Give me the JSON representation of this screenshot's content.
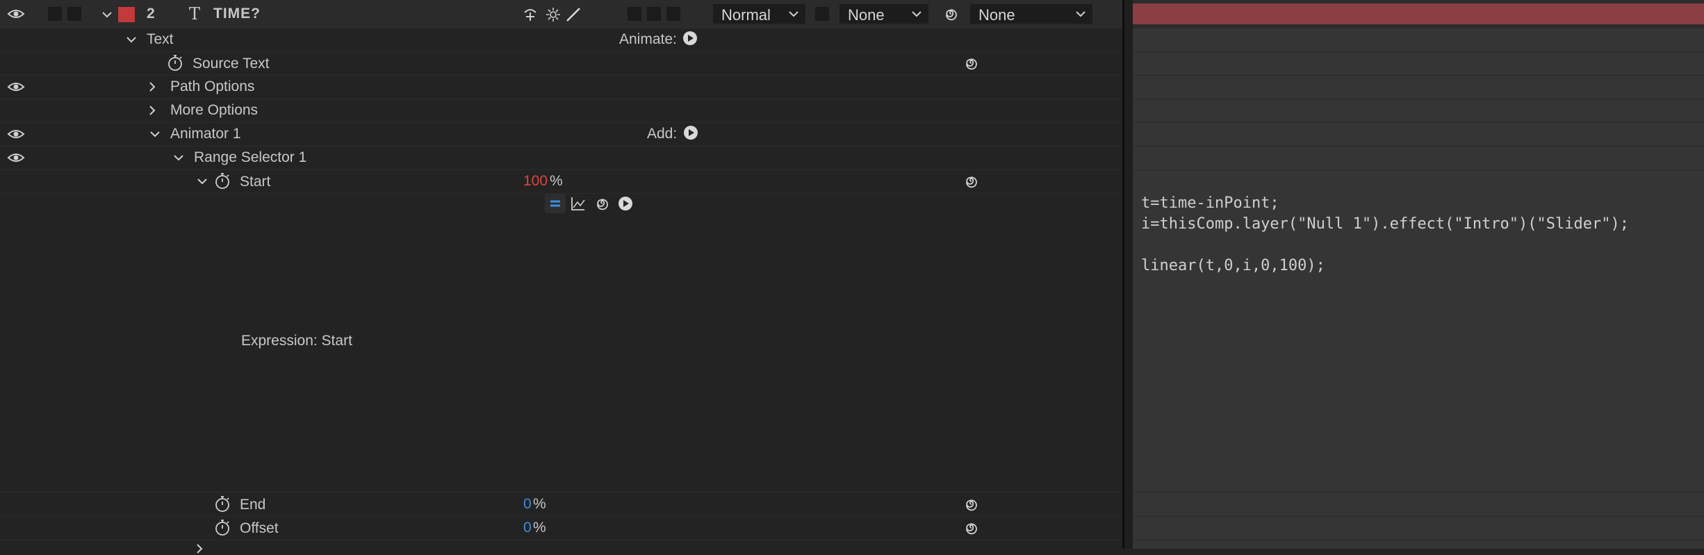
{
  "layer": {
    "number": "2",
    "type_glyph": "T",
    "name": "TIME?",
    "label_color": "#c33a3a",
    "blend_mode": "Normal",
    "track_matte": "None",
    "parent": "None",
    "bar_color": "#8a3f44"
  },
  "props": {
    "text": "Text",
    "animate_label": "Animate:",
    "source_text": "Source Text",
    "path_options": "Path Options",
    "more_options": "More Options",
    "animator": "Animator 1",
    "add_label": "Add:",
    "range_selector": "Range Selector 1",
    "start": "Start",
    "start_value": "100",
    "start_unit": "%",
    "expression_label": "Expression: Start",
    "end": "End",
    "end_value": "0",
    "end_unit": "%",
    "offset": "Offset",
    "offset_value": "0",
    "offset_unit": "%"
  },
  "expression": {
    "line1": "t=time-inPoint;",
    "line2": "i=thisComp.layer(\"Null 1\").effect(\"Intro\")(\"Slider\");",
    "line3": "",
    "line4": "linear(t,0,i,0,100);"
  },
  "icons": {
    "eye": "eye-icon",
    "stopwatch": "stopwatch-icon",
    "spiral": "expression-spiral-icon",
    "play": "play-menu-icon",
    "chevron": "chevron-icon"
  },
  "colors": {
    "value_red": "#e0443d",
    "value_blue": "#3a8ee6"
  }
}
